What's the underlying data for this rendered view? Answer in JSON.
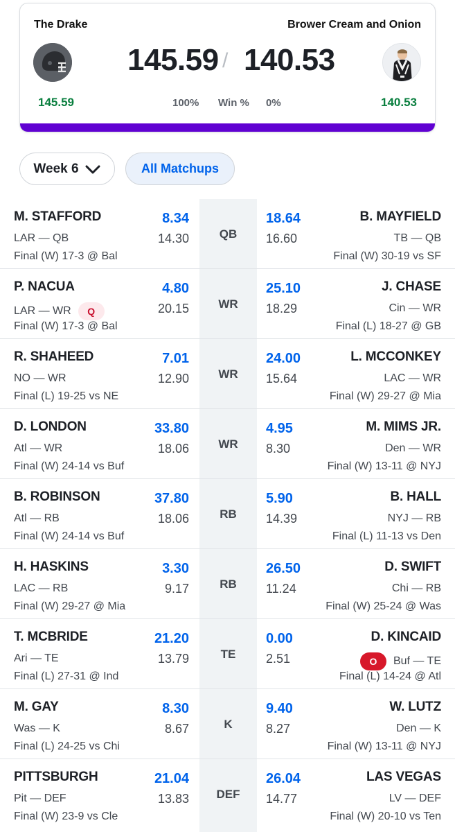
{
  "header": {
    "left_team": {
      "name": "The Drake",
      "score": "145.59",
      "sub_score": "145.59",
      "win_pct": "100%",
      "avatar_icon": "football-helmet-icon"
    },
    "right_team": {
      "name": "Brower Cream and Onion",
      "score": "140.53",
      "sub_score": "140.53",
      "win_pct": "0%",
      "avatar_icon": "person-avatar-icon"
    },
    "separator": "/",
    "win_label": "Win %",
    "accent_color": "#6001d2"
  },
  "controls": {
    "week_label": "Week 6",
    "all_matchups_label": "All Matchups"
  },
  "roster": [
    {
      "pos": "QB",
      "left": {
        "name": "M. STAFFORD",
        "team": "LAR — QB",
        "badge": "",
        "points": "8.34",
        "proj": "14.30",
        "game": "Final (W) 17-3 @ Bal"
      },
      "right": {
        "name": "B. MAYFIELD",
        "team": "TB — QB",
        "badge": "",
        "points": "18.64",
        "proj": "16.60",
        "game": "Final (W) 30-19 vs SF"
      }
    },
    {
      "pos": "WR",
      "left": {
        "name": "P. NACUA",
        "team": "LAR — WR",
        "badge": "Q",
        "points": "4.80",
        "proj": "20.15",
        "game": "Final (W) 17-3 @ Bal"
      },
      "right": {
        "name": "J. CHASE",
        "team": "Cin — WR",
        "badge": "",
        "points": "25.10",
        "proj": "18.29",
        "game": "Final (L) 18-27 @ GB"
      }
    },
    {
      "pos": "WR",
      "left": {
        "name": "R. SHAHEED",
        "team": "NO — WR",
        "badge": "",
        "points": "7.01",
        "proj": "12.90",
        "game": "Final (L) 19-25 vs NE"
      },
      "right": {
        "name": "L. MCCONKEY",
        "team": "LAC — WR",
        "badge": "",
        "points": "24.00",
        "proj": "15.64",
        "game": "Final (W) 29-27 @ Mia"
      }
    },
    {
      "pos": "WR",
      "left": {
        "name": "D. LONDON",
        "team": "Atl — WR",
        "badge": "",
        "points": "33.80",
        "proj": "18.06",
        "game": "Final (W) 24-14 vs Buf"
      },
      "right": {
        "name": "M. MIMS JR.",
        "team": "Den — WR",
        "badge": "",
        "points": "4.95",
        "proj": "8.30",
        "game": "Final (W) 13-11 @ NYJ"
      }
    },
    {
      "pos": "RB",
      "left": {
        "name": "B. ROBINSON",
        "team": "Atl — RB",
        "badge": "",
        "points": "37.80",
        "proj": "18.06",
        "game": "Final (W) 24-14 vs Buf"
      },
      "right": {
        "name": "B. HALL",
        "team": "NYJ — RB",
        "badge": "",
        "points": "5.90",
        "proj": "14.39",
        "game": "Final (L) 11-13 vs Den"
      }
    },
    {
      "pos": "RB",
      "left": {
        "name": "H. HASKINS",
        "team": "LAC — RB",
        "badge": "",
        "points": "3.30",
        "proj": "9.17",
        "game": "Final (W) 29-27 @ Mia"
      },
      "right": {
        "name": "D. SWIFT",
        "team": "Chi — RB",
        "badge": "",
        "points": "26.50",
        "proj": "11.24",
        "game": "Final (W) 25-24 @ Was"
      }
    },
    {
      "pos": "TE",
      "left": {
        "name": "T. MCBRIDE",
        "team": "Ari — TE",
        "badge": "",
        "points": "21.20",
        "proj": "13.79",
        "game": "Final (L) 27-31 @ Ind"
      },
      "right": {
        "name": "D. KINCAID",
        "team": "Buf — TE",
        "badge": "O",
        "points": "0.00",
        "proj": "2.51",
        "game": "Final (L) 14-24 @ Atl"
      }
    },
    {
      "pos": "K",
      "left": {
        "name": "M. GAY",
        "team": "Was — K",
        "badge": "",
        "points": "8.30",
        "proj": "8.67",
        "game": "Final (L) 24-25 vs Chi"
      },
      "right": {
        "name": "W. LUTZ",
        "team": "Den — K",
        "badge": "",
        "points": "9.40",
        "proj": "8.27",
        "game": "Final (W) 13-11 @ NYJ"
      }
    },
    {
      "pos": "DEF",
      "left": {
        "name": "PITTSBURGH",
        "team": "Pit — DEF",
        "badge": "",
        "points": "21.04",
        "proj": "13.83",
        "game": "Final (W) 23-9 vs Cle"
      },
      "right": {
        "name": "LAS VEGAS",
        "team": "LV — DEF",
        "badge": "",
        "points": "26.04",
        "proj": "14.77",
        "game": "Final (W) 20-10 vs Ten"
      }
    }
  ]
}
